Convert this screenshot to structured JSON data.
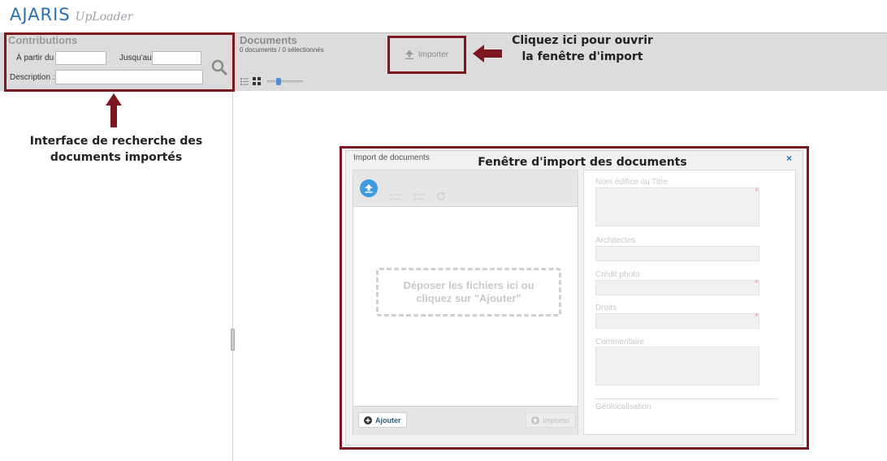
{
  "app": {
    "brand": "AJARIS",
    "product": "UpLoader"
  },
  "left_panel": {
    "title": "Contributions",
    "from_label": "À partir du :",
    "to_label": "Jusqu'au:",
    "description_label": "Description :",
    "search_icon": "search-icon"
  },
  "documents": {
    "title": "Documents",
    "count": "0 documents / 0 sélectionnés",
    "import_button": "Importer"
  },
  "annotations": {
    "import_hint": "Cliquez ici pour ouvrir\nla fenêtre d'import",
    "search_hint": "Interface de recherche des\ndocuments importés",
    "window_hint": "Fenêtre d'import des documents"
  },
  "import_window": {
    "title": "Import de documents",
    "close": "×",
    "dropzone_text": "Déposer les fichiers ici ou\ncliquez sur \"Ajouter\"",
    "add_button": "Ajouter",
    "import_button": "Importer",
    "form": {
      "title_label": "Nom édifice ou Titre",
      "architects_label": "Architectes",
      "credit_label": "Crédit photo",
      "rights_label": "Droits",
      "comment_label": "Commentaire",
      "geo_label": "Géolocalisation"
    }
  },
  "colors": {
    "highlight": "#7d1621",
    "accent_blue": "#3f9be0",
    "band_gray": "#dcdcdc"
  }
}
